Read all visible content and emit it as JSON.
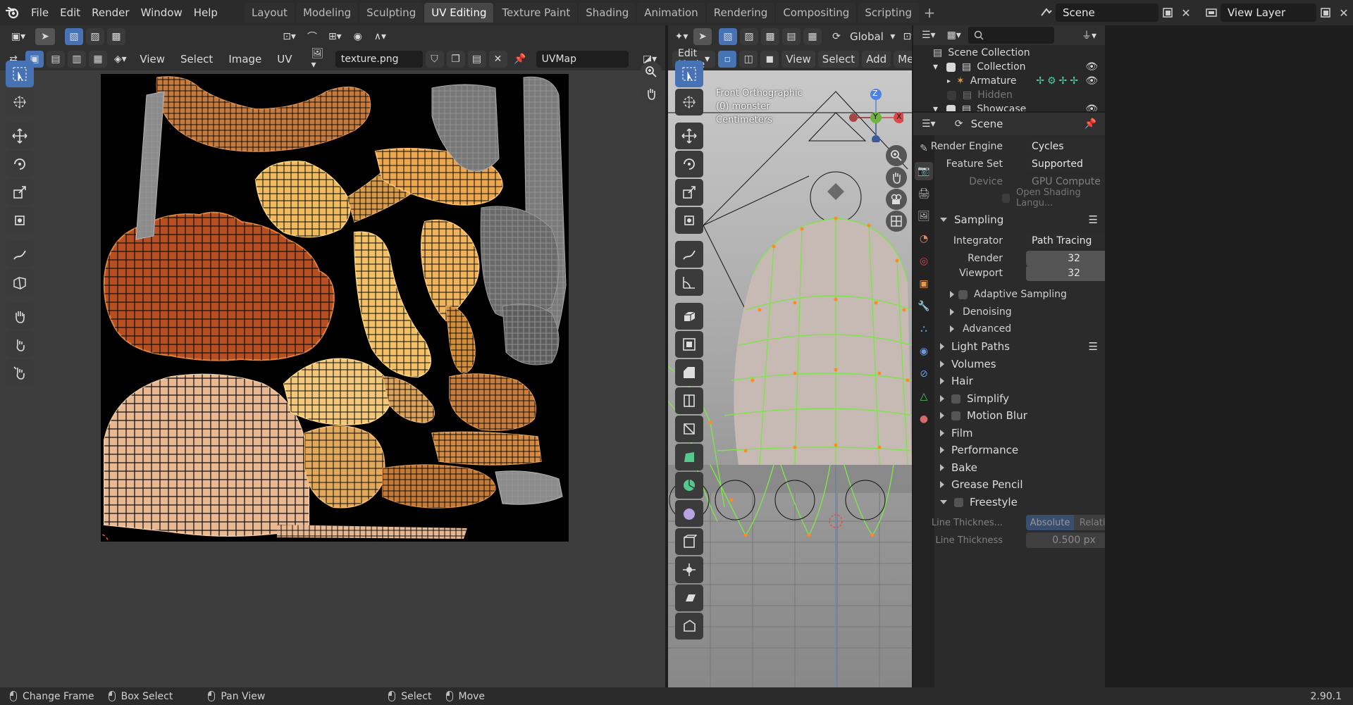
{
  "topbar": {
    "menus": [
      "File",
      "Edit",
      "Render",
      "Window",
      "Help"
    ],
    "workspaces": [
      "Layout",
      "Modeling",
      "Sculpting",
      "UV Editing",
      "Texture Paint",
      "Shading",
      "Animation",
      "Rendering",
      "Compositing",
      "Scripting"
    ],
    "active_workspace": "UV Editing",
    "scene": "Scene",
    "view_layer": "View Layer"
  },
  "uv_editor": {
    "menus": [
      "View",
      "Select",
      "Image",
      "UV"
    ],
    "image_name": "texture.png",
    "uv_map": "UVMap"
  },
  "viewport": {
    "mode": "Edit Mode",
    "menus": [
      "View",
      "Select",
      "Add",
      "Mesh"
    ],
    "orientation": "Global",
    "overlay_lines": [
      "Front Orthographic",
      "(0) monster",
      "Centimeters"
    ],
    "gizmo_axes": [
      "Z",
      "Y",
      "X"
    ]
  },
  "outliner": {
    "rows": [
      {
        "label": "Scene Collection",
        "level": 0
      },
      {
        "label": "Collection",
        "level": 1
      },
      {
        "label": "Armature",
        "level": 2
      },
      {
        "label": "Hidden",
        "level": 1
      },
      {
        "label": "Showcase",
        "level": 1
      }
    ]
  },
  "properties": {
    "context": "Scene",
    "render_engine": {
      "label": "Render Engine",
      "value": "Cycles"
    },
    "feature_set": {
      "label": "Feature Set",
      "value": "Supported"
    },
    "device": {
      "label": "Device",
      "value": "GPU Compute"
    },
    "open_shading": "Open Shading Langu...",
    "sampling": {
      "title": "Sampling",
      "integrator_label": "Integrator",
      "integrator": "Path Tracing",
      "render_label": "Render",
      "render": "32",
      "viewport_label": "Viewport",
      "viewport": "32",
      "subsections": [
        "Adaptive Sampling",
        "Denoising",
        "Advanced"
      ]
    },
    "sections": [
      "Light Paths",
      "Volumes",
      "Hair",
      "Simplify",
      "Motion Blur",
      "Film",
      "Performance",
      "Bake",
      "Grease Pencil",
      "Freestyle"
    ],
    "freestyle": {
      "line_thickness_mode_label": "Line Thicknes...",
      "mode_absolute": "Absolute",
      "mode_relative": "Relative",
      "line_thickness_label": "Line Thickness",
      "line_thickness": "0.500 px"
    }
  },
  "statusbar": {
    "items": [
      "Change Frame",
      "Box Select",
      "Pan View",
      "Select",
      "Move"
    ],
    "version": "2.90.1"
  },
  "colors": {
    "accent": "#4772b3",
    "wire_select": "#7fe34d",
    "vert_select": "#ff8c1a"
  }
}
